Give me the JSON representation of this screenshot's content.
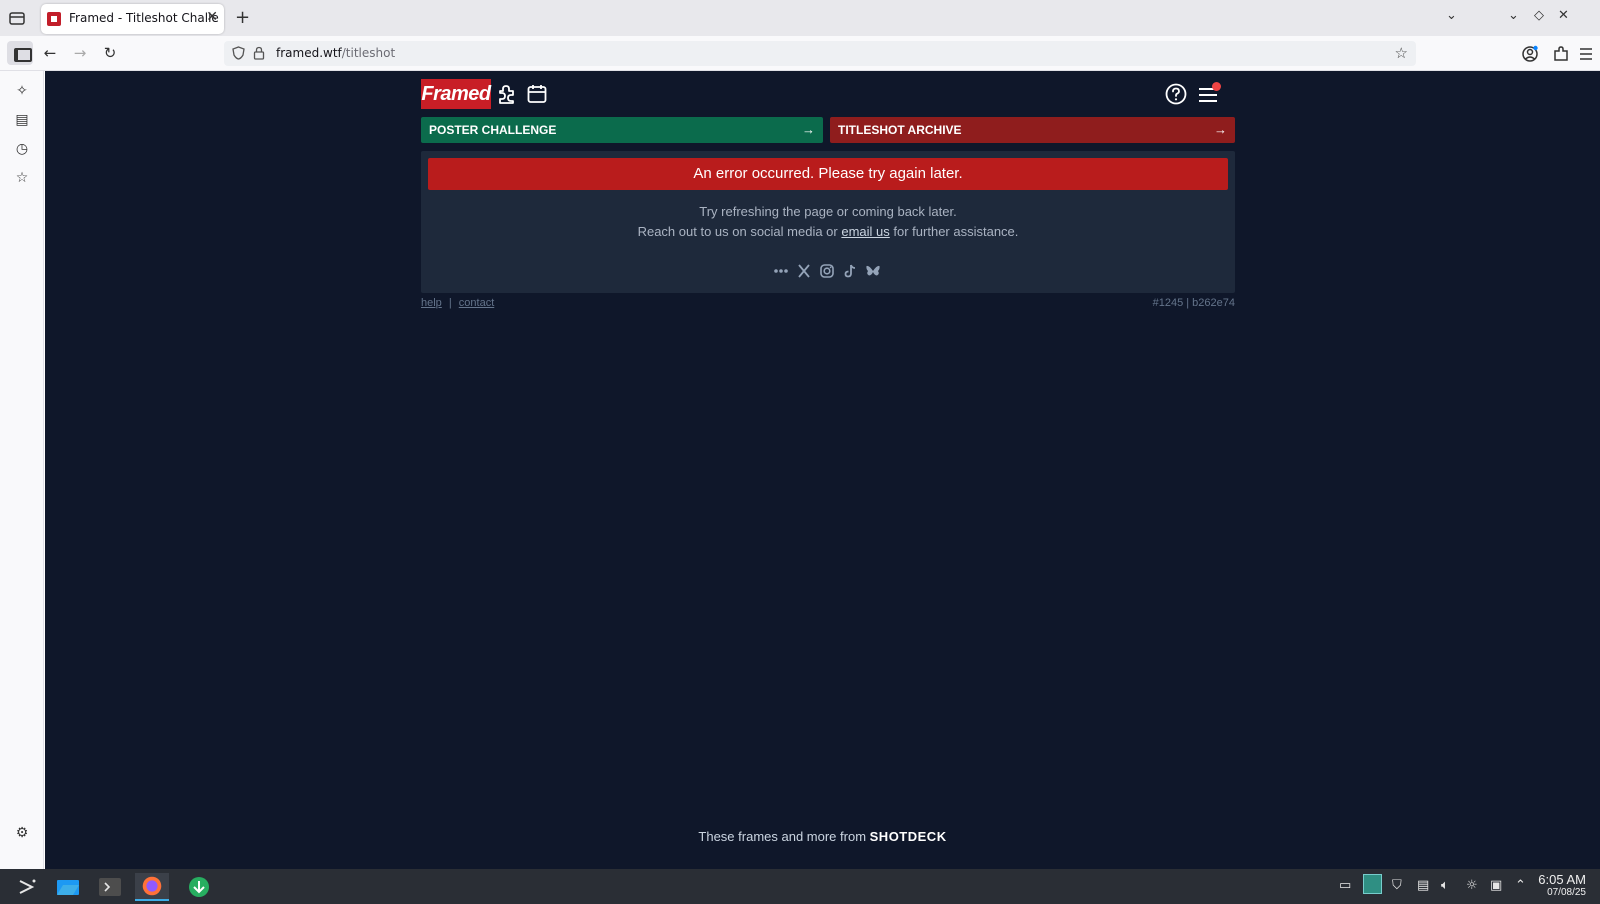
{
  "browser": {
    "tab_title": "Framed - Titleshot Challenge",
    "tab_close": "✕",
    "new_tab": "+",
    "url_host": "framed.wtf",
    "url_path": "/titleshot",
    "back": "←",
    "forward": "→",
    "reload": "↻",
    "bookmark_star": "☆"
  },
  "header": {
    "logo": "Framed"
  },
  "challenges": {
    "poster_label": "POSTER CHALLENGE",
    "archive_label": "TITLESHOT ARCHIVE",
    "arrow": "→"
  },
  "error": {
    "banner": "An error occurred. Please try again later.",
    "line1": "Try refreshing the page or coming back later.",
    "line2_prefix": "Reach out to us on social media or ",
    "line2_link": "email us",
    "line2_suffix": " for further assistance."
  },
  "footer": {
    "help": "help",
    "separator": "|",
    "contact": "contact",
    "build": "#1245 | b262e74"
  },
  "credit": {
    "prefix": "These frames and more from ",
    "brand": "SHOTDECK"
  },
  "taskbar": {
    "time": "6:05 AM",
    "date": "07/08/25"
  },
  "colors": {
    "page_bg": "#0f172a",
    "card_bg": "#1e293b",
    "logo_red": "#c81e26",
    "poster_green": "#0b6b4c",
    "archive_red": "#8f1d1d",
    "error_red": "#b91c1c"
  }
}
